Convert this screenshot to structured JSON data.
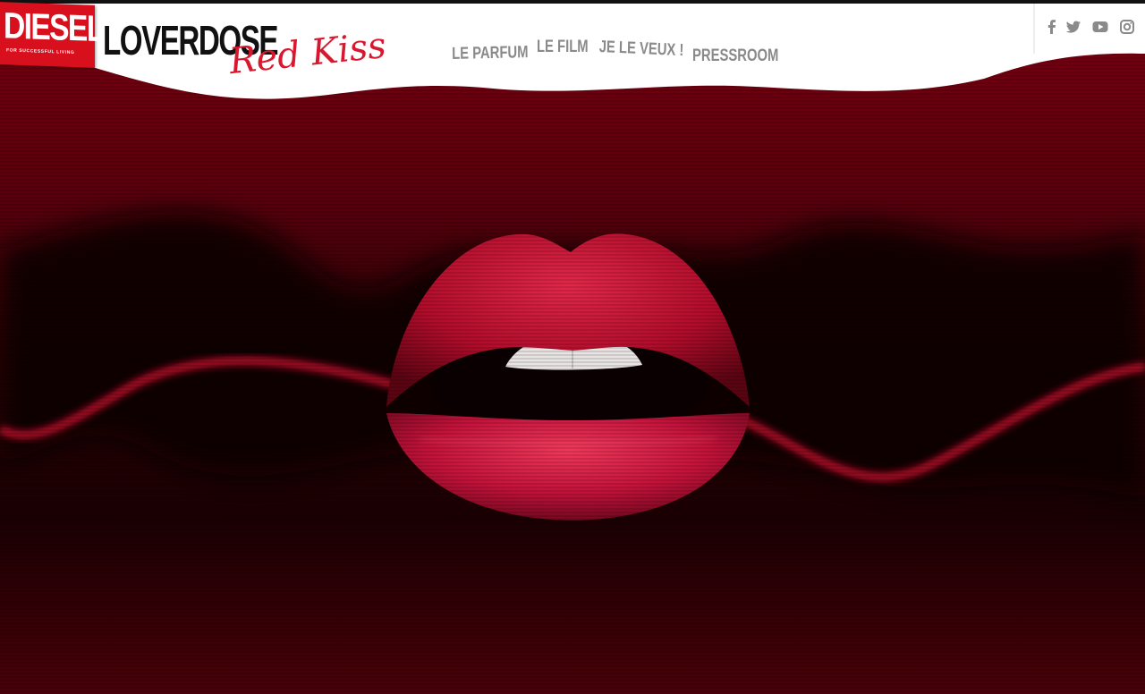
{
  "brand": {
    "logo_word": "DIESEL",
    "logo_tagline": "FOR SUCCESSFUL LIVING",
    "product_name": "LOVERDOSE",
    "product_script": "Red Kiss"
  },
  "nav": {
    "items": [
      {
        "label": "LE PARFUM"
      },
      {
        "label": "LE FILM"
      },
      {
        "label": "JE LE VEUX !"
      },
      {
        "label": "PRESSROOM"
      }
    ]
  },
  "social": {
    "icons": [
      "facebook-icon",
      "twitter-icon",
      "youtube-icon",
      "instagram-icon"
    ]
  },
  "colors": {
    "brand_red": "#d8101e",
    "script_red": "#d8182e",
    "nav_gray": "#8a8a8a",
    "header_bg": "#ffffff",
    "hero_bg": "#2a0006"
  }
}
